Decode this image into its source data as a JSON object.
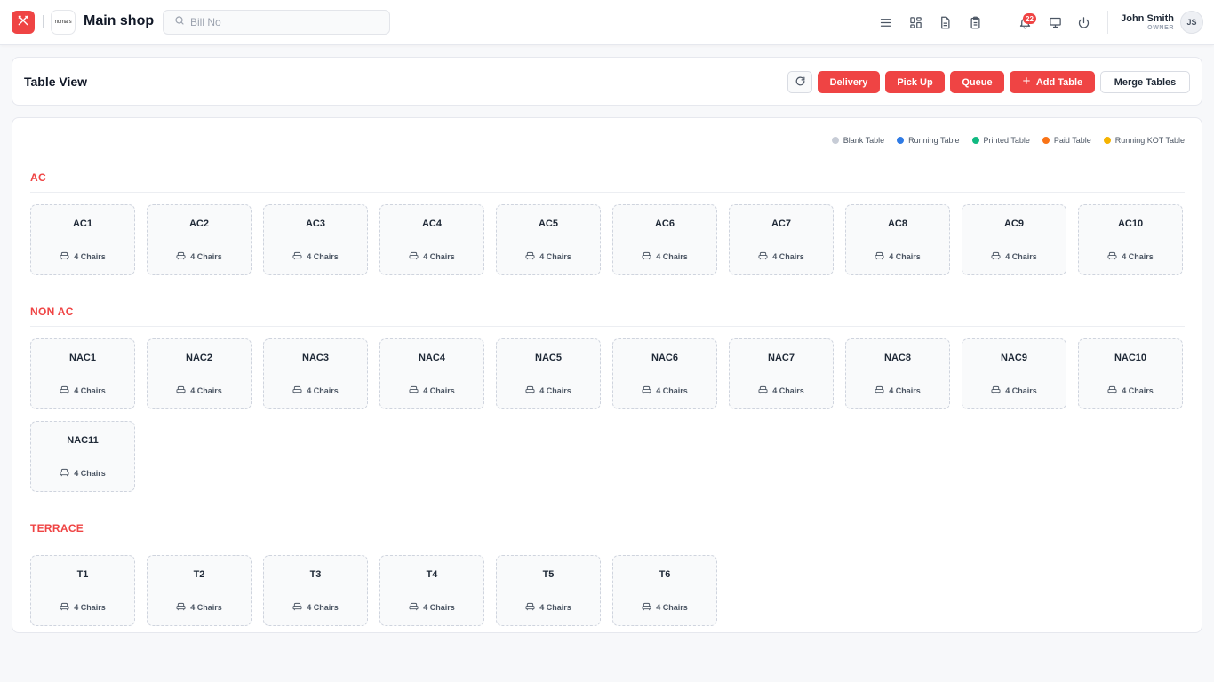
{
  "header": {
    "logo_text": "nomars",
    "shop_name": "Main shop",
    "search_placeholder": "Bill No",
    "notification_count": "22",
    "user_name": "John Smith",
    "user_role": "OWNER",
    "user_initials": "JS"
  },
  "toolbar": {
    "title": "Table View",
    "buttons": {
      "delivery": "Delivery",
      "pickup": "Pick Up",
      "queue": "Queue",
      "add_table": "Add Table",
      "merge_tables": "Merge Tables"
    }
  },
  "legend": [
    {
      "label": "Blank Table",
      "color": "#c7ccd6"
    },
    {
      "label": "Running Table",
      "color": "#2f7be5"
    },
    {
      "label": "Printed Table",
      "color": "#10b981"
    },
    {
      "label": "Paid Table",
      "color": "#f97316"
    },
    {
      "label": "Running KOT Table",
      "color": "#f5b301"
    }
  ],
  "colors": {
    "accent": "#ef4444",
    "text": "#1f2937"
  },
  "sections": [
    {
      "title": "AC",
      "tables": [
        {
          "name": "AC1",
          "chairs": "4 Chairs"
        },
        {
          "name": "AC2",
          "chairs": "4 Chairs"
        },
        {
          "name": "AC3",
          "chairs": "4 Chairs"
        },
        {
          "name": "AC4",
          "chairs": "4 Chairs"
        },
        {
          "name": "AC5",
          "chairs": "4 Chairs"
        },
        {
          "name": "AC6",
          "chairs": "4 Chairs"
        },
        {
          "name": "AC7",
          "chairs": "4 Chairs"
        },
        {
          "name": "AC8",
          "chairs": "4 Chairs"
        },
        {
          "name": "AC9",
          "chairs": "4 Chairs"
        },
        {
          "name": "AC10",
          "chairs": "4 Chairs"
        }
      ]
    },
    {
      "title": "NON AC",
      "tables": [
        {
          "name": "NAC1",
          "chairs": "4 Chairs"
        },
        {
          "name": "NAC2",
          "chairs": "4 Chairs"
        },
        {
          "name": "NAC3",
          "chairs": "4 Chairs"
        },
        {
          "name": "NAC4",
          "chairs": "4 Chairs"
        },
        {
          "name": "NAC5",
          "chairs": "4 Chairs"
        },
        {
          "name": "NAC6",
          "chairs": "4 Chairs"
        },
        {
          "name": "NAC7",
          "chairs": "4 Chairs"
        },
        {
          "name": "NAC8",
          "chairs": "4 Chairs"
        },
        {
          "name": "NAC9",
          "chairs": "4 Chairs"
        },
        {
          "name": "NAC10",
          "chairs": "4 Chairs"
        },
        {
          "name": "NAC11",
          "chairs": "4 Chairs"
        }
      ]
    },
    {
      "title": "TERRACE",
      "tables": [
        {
          "name": "T1",
          "chairs": "4 Chairs"
        },
        {
          "name": "T2",
          "chairs": "4 Chairs"
        },
        {
          "name": "T3",
          "chairs": "4 Chairs"
        },
        {
          "name": "T4",
          "chairs": "4 Chairs"
        },
        {
          "name": "T5",
          "chairs": "4 Chairs"
        },
        {
          "name": "T6",
          "chairs": "4 Chairs"
        }
      ]
    }
  ]
}
